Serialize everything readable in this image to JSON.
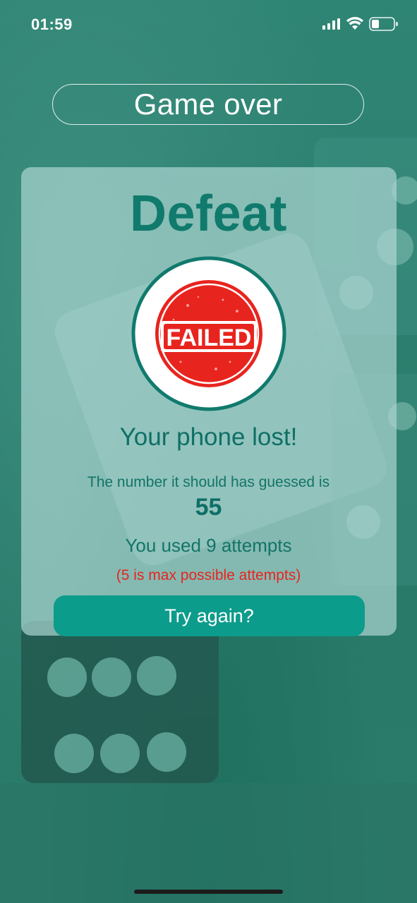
{
  "status_bar": {
    "time": "01:59",
    "icons": [
      "cellular-signal-icon",
      "wifi-icon",
      "battery-icon"
    ]
  },
  "header": {
    "title": "Game over"
  },
  "result": {
    "heading": "Defeat",
    "stamp_text": "FAILED",
    "message": "Your phone lost!",
    "guessed_label": "The number it should has guessed is",
    "guessed_number": "55",
    "attempts_text": "You used 9 attempts",
    "max_attempts_note": "(5 is max possible attempts)"
  },
  "actions": {
    "try_again_label": "Try again?"
  },
  "colors": {
    "background": "#2e8272",
    "accent": "#0c9c8b",
    "heading": "#107a6d",
    "stamp_red": "#e8241e",
    "note_red": "#e8241e"
  }
}
